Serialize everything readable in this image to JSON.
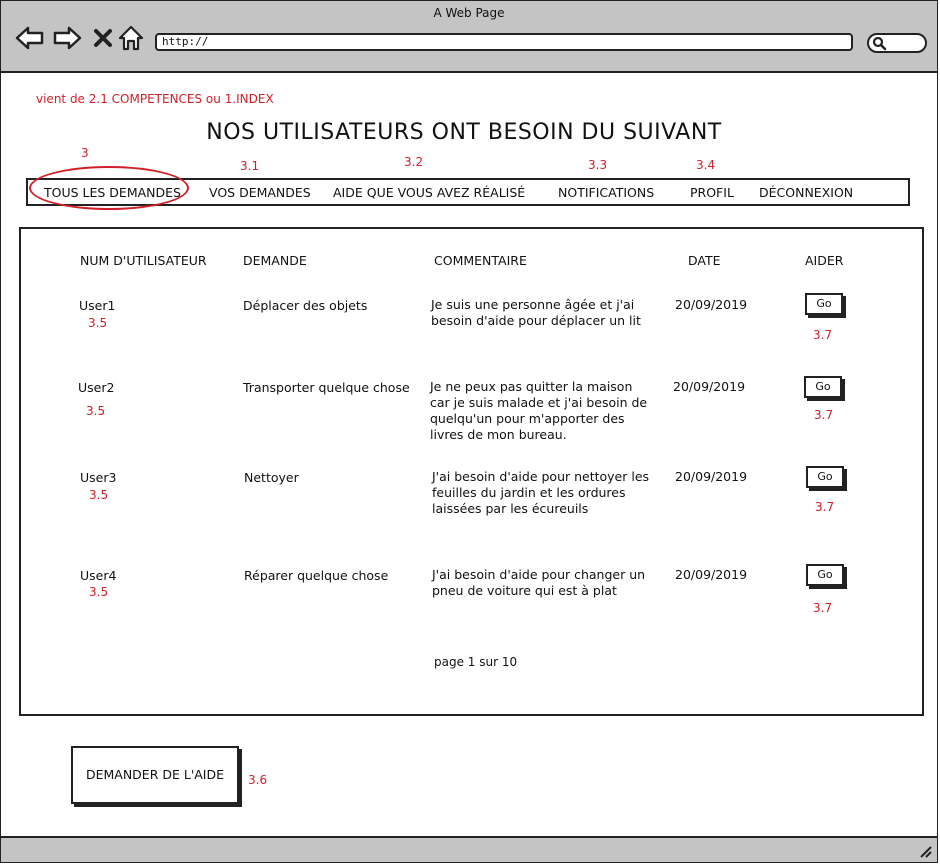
{
  "window": {
    "title": "A Web Page",
    "url": "http://"
  },
  "source_note": "vient de 2.1 COMPETENCES ou 1.INDEX",
  "heading": "NOS UTILISATEURS ONT BESOIN DU SUIVANT",
  "nav": {
    "items": [
      {
        "label": "TOUS LES DEMANDES",
        "note": "3"
      },
      {
        "label": "VOS DEMANDES",
        "note": "3.1"
      },
      {
        "label": "AIDE QUE VOUS AVEZ RÉALISÉ",
        "note": "3.2"
      },
      {
        "label": "NOTIFICATIONS",
        "note": "3.3"
      },
      {
        "label": "PROFIL",
        "note": "3.4"
      },
      {
        "label": "DÉCONNEXION",
        "note": ""
      }
    ]
  },
  "table": {
    "headers": [
      "NUM D'UTILISATEUR",
      "DEMANDE",
      "COMMENTAIRE",
      "DATE",
      "AIDER"
    ],
    "rows": [
      {
        "user": "User1",
        "user_note": "3.5",
        "demande": "Déplacer des objets",
        "commentaire": "Je suis une personne âgée et j'ai besoin d'aide pour déplacer un lit",
        "date": "20/09/2019",
        "button": "Go",
        "button_note": "3.7"
      },
      {
        "user": "User2",
        "user_note": "3.5",
        "demande": "Transporter quelque chose",
        "commentaire": "Je ne peux pas quitter la maison car je suis malade et j'ai besoin de quelqu'un pour m'apporter des livres de mon bureau.",
        "date": "20/09/2019",
        "button": "Go",
        "button_note": "3.7"
      },
      {
        "user": "User3",
        "user_note": "3.5",
        "demande": "Nettoyer",
        "commentaire": "J'ai besoin d'aide pour nettoyer les feuilles du jardin et les ordures laissées par les écureuils",
        "date": "20/09/2019",
        "button": "Go",
        "button_note": "3.7"
      },
      {
        "user": "User4",
        "user_note": "3.5",
        "demande": "Réparer quelque chose",
        "commentaire": "J'ai besoin d'aide pour changer un pneu de voiture qui est à plat",
        "date": "20/09/2019",
        "button": "Go",
        "button_note": "3.7"
      }
    ]
  },
  "pager": "page 1 sur 10",
  "ask_button": {
    "label": "DEMANDER DE L'AIDE",
    "note": "3.6"
  },
  "colors": {
    "annotation": "#d0202a",
    "chrome": "#c4c4c4"
  }
}
